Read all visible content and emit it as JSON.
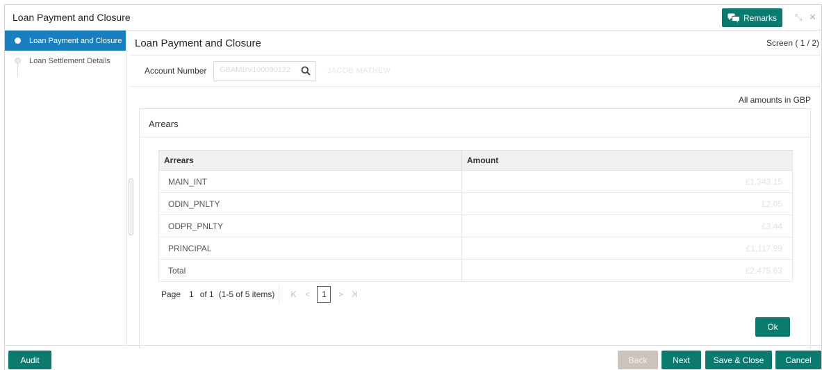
{
  "window": {
    "title": "Loan Payment and Closure",
    "remarks_label": "Remarks",
    "minimize_glyph": "⤡",
    "close_glyph": "✕"
  },
  "sidebar": {
    "items": [
      {
        "label": "Loan Payment and Closure",
        "active": true
      },
      {
        "label": "Loan Settlement Details",
        "active": false
      }
    ]
  },
  "main": {
    "title": "Loan Payment and Closure",
    "screen_indicator": "Screen ( 1 / 2)",
    "account_label": "Account Number",
    "account_value": "GBAMBV100090122",
    "account_name": "JACOB MATHEW",
    "amount_note": "All amounts in GBP"
  },
  "arrears": {
    "card_title": "Arrears",
    "columns": [
      "Arrears",
      "Amount"
    ],
    "rows": [
      {
        "name": "MAIN_INT",
        "amount": "£1,343.15"
      },
      {
        "name": "ODIN_PNLTY",
        "amount": "£2.05"
      },
      {
        "name": "ODPR_PNLTY",
        "amount": "£3.44"
      },
      {
        "name": "PRINCIPAL",
        "amount": "£1,117.99"
      },
      {
        "name": "Total",
        "amount": "£2,475.63"
      }
    ],
    "pagination": {
      "page_label": "Page",
      "page_number": "1",
      "of_text": "of 1",
      "items_text": "(1-5 of 5 items)",
      "current": "1",
      "first_glyph": "K",
      "prev_glyph": "<",
      "next_glyph": ">",
      "last_glyph": "K"
    },
    "ok_label": "Ok"
  },
  "footer": {
    "audit": "Audit",
    "back": "Back",
    "next": "Next",
    "save_close": "Save & Close",
    "cancel": "Cancel"
  },
  "colors": {
    "primary": "#0d7a6f",
    "sidebar_active": "#1a7fc0",
    "disabled": "#cdc3bb"
  }
}
